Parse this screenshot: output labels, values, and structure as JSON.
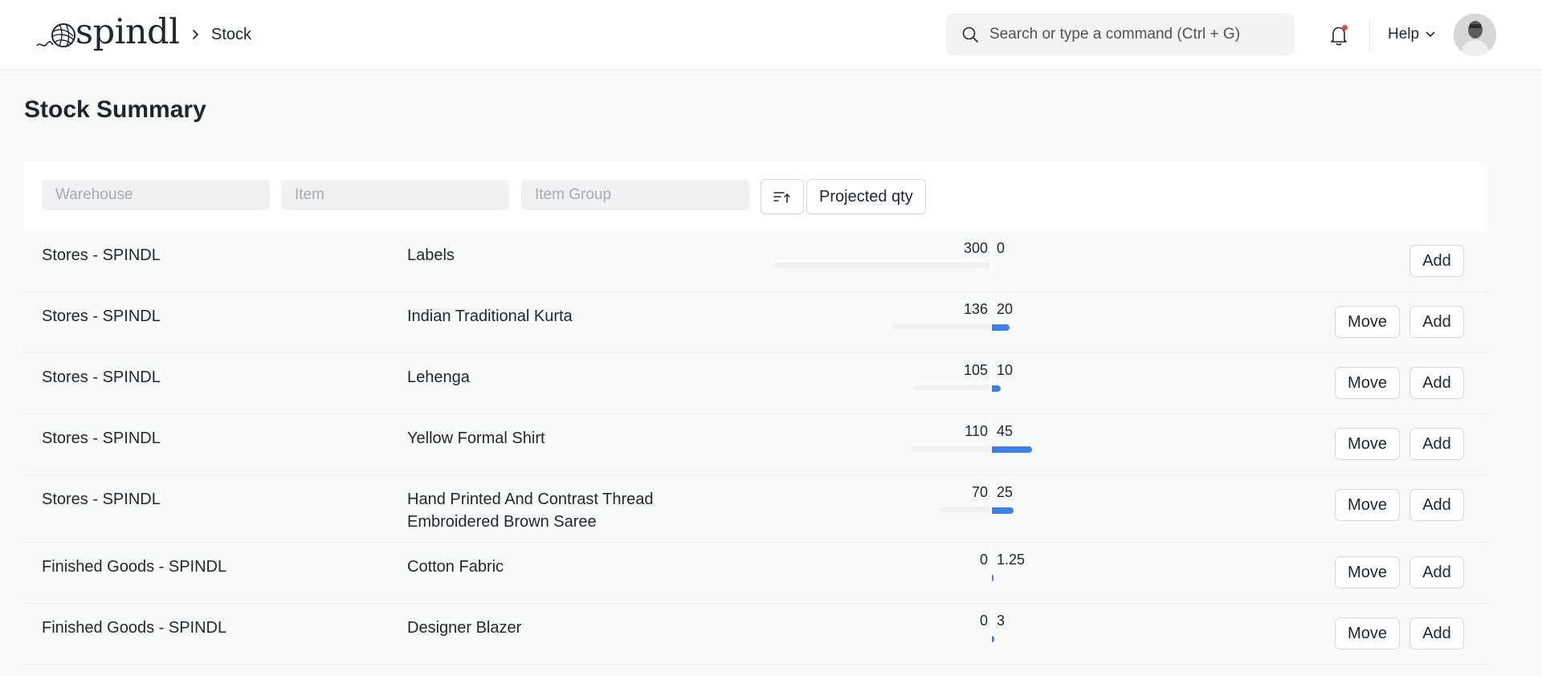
{
  "app": {
    "brand": "spindl",
    "breadcrumb": "Stock"
  },
  "search": {
    "placeholder": "Search or type a command (Ctrl + G)"
  },
  "header": {
    "help_label": "Help"
  },
  "page": {
    "title": "Stock Summary"
  },
  "filters": {
    "warehouse_placeholder": "Warehouse",
    "item_placeholder": "Item",
    "item_group_placeholder": "Item Group",
    "projected_label": "Projected qty"
  },
  "rows": [
    {
      "warehouse": "Stores - SPINDL",
      "item": "Labels",
      "qty_left": "300",
      "qty_right": "0",
      "left_fraction": 1.0,
      "right_fraction": 0.0,
      "move": false,
      "move_label": "Move",
      "add_label": "Add"
    },
    {
      "warehouse": "Stores - SPINDL",
      "item": "Indian Traditional Kurta",
      "qty_left": "136",
      "qty_right": "20",
      "left_fraction": 0.453,
      "right_fraction": 0.066,
      "move": true,
      "move_label": "Move",
      "add_label": "Add"
    },
    {
      "warehouse": "Stores - SPINDL",
      "item": "Lehenga",
      "qty_left": "105",
      "qty_right": "10",
      "left_fraction": 0.35,
      "right_fraction": 0.033,
      "move": true,
      "move_label": "Move",
      "add_label": "Add"
    },
    {
      "warehouse": "Stores - SPINDL",
      "item": "Yellow Formal Shirt",
      "qty_left": "110",
      "qty_right": "45",
      "left_fraction": 0.367,
      "right_fraction": 0.15,
      "move": true,
      "move_label": "Move",
      "add_label": "Add"
    },
    {
      "warehouse": "Stores - SPINDL",
      "item": "Hand Printed And Contrast Thread Embroidered Brown Saree",
      "qty_left": "70",
      "qty_right": "25",
      "left_fraction": 0.233,
      "right_fraction": 0.083,
      "move": true,
      "move_label": "Move",
      "add_label": "Add"
    },
    {
      "warehouse": "Finished Goods - SPINDL",
      "item": "Cotton Fabric",
      "qty_left": "0",
      "qty_right": "1.25",
      "left_fraction": 0.0,
      "right_fraction": 0.004,
      "move": true,
      "move_label": "Move",
      "add_label": "Add"
    },
    {
      "warehouse": "Finished Goods - SPINDL",
      "item": "Designer Blazer",
      "qty_left": "0",
      "qty_right": "3",
      "left_fraction": 0.0,
      "right_fraction": 0.01,
      "move": true,
      "move_label": "Move",
      "add_label": "Add"
    }
  ],
  "colors": {
    "accent": "#3f80e4",
    "notification_dot": "#e24c4c"
  },
  "icons": {
    "search": "search-icon",
    "bell": "bell-icon",
    "sort": "sort-ascending-icon",
    "chevron": "chevron-down-icon"
  }
}
